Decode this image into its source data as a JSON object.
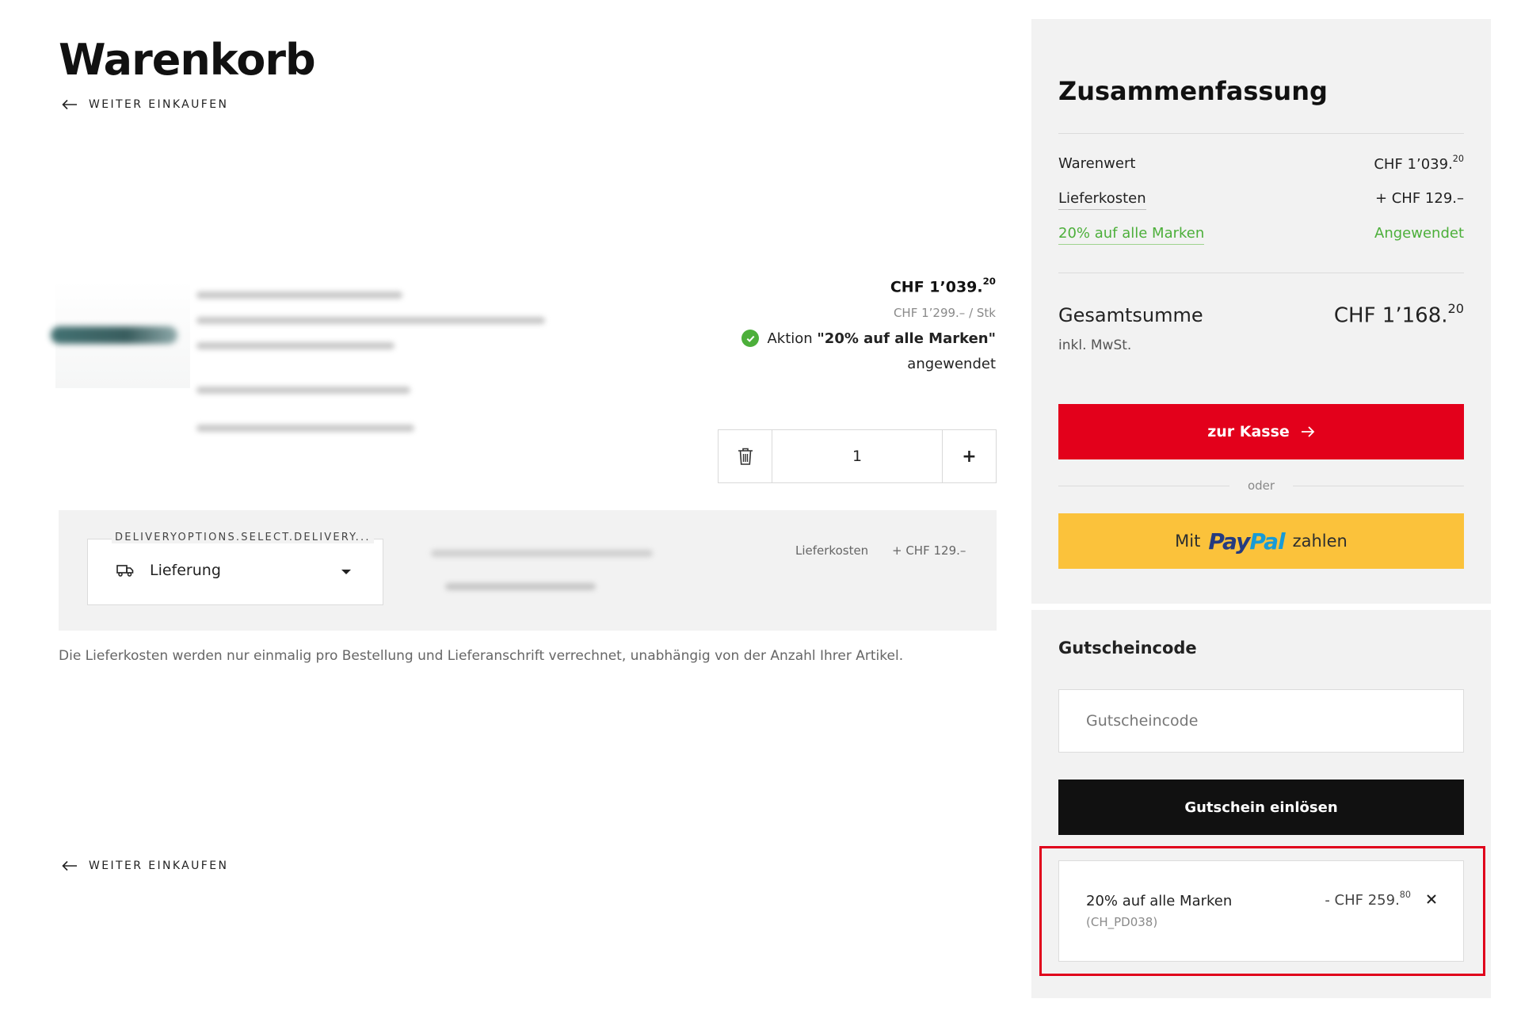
{
  "page": {
    "title": "Warenkorb",
    "back_link": "WEITER EINKAUFEN"
  },
  "cart_item": {
    "price": "CHF 1’039.",
    "price_cents": "20",
    "unit_price": "CHF 1’299.– / Stk",
    "promo_prefix": "Aktion ",
    "promo_name": "\"20% auf alle Marken\"",
    "promo_status": "angewendet",
    "quantity": "1",
    "plus_label": "+"
  },
  "delivery": {
    "select_label": "DELIVERYOPTIONS.SELECT.DELIVERY...",
    "selected_option": "Lieferung",
    "cost_label": "Lieferkosten",
    "cost_value": "+ CHF 129.–",
    "note": "Die Lieferkosten werden nur einmalig pro Bestellung und Lieferanschrift verrechnet, unabhängig von der Anzahl Ihrer Artikel."
  },
  "summary": {
    "title": "Zusammenfassung",
    "rows": [
      {
        "label": "Warenwert",
        "value": "CHF 1’039.",
        "cents": "20"
      },
      {
        "label": "Lieferkosten",
        "value": "+ CHF 129.–",
        "cents": ""
      },
      {
        "label": "20% auf alle Marken",
        "value": "Angewendet",
        "cents": ""
      }
    ],
    "total_label": "Gesamtsumme",
    "total_value": "CHF 1’168.",
    "total_cents": "20",
    "vat_note": "inkl. MwSt.",
    "checkout_label": "zur Kasse",
    "or_label": "oder",
    "paypal_prefix": "Mit",
    "paypal_brand_1": "Pay",
    "paypal_brand_2": "Pal",
    "paypal_suffix": "zahlen"
  },
  "coupon": {
    "title": "Gutscheincode",
    "placeholder": "Gutscheincode",
    "redeem_label": "Gutschein einlösen",
    "applied": {
      "name": "20% auf alle Marken",
      "code": "(CH_PD038)",
      "amount": "- CHF 259.",
      "amount_cents": "80"
    }
  },
  "colors": {
    "accent_red": "#e3001b",
    "success_green": "#4caf3a",
    "paypal_yellow": "#fbc23b",
    "panel_gray": "#f2f2f2"
  }
}
